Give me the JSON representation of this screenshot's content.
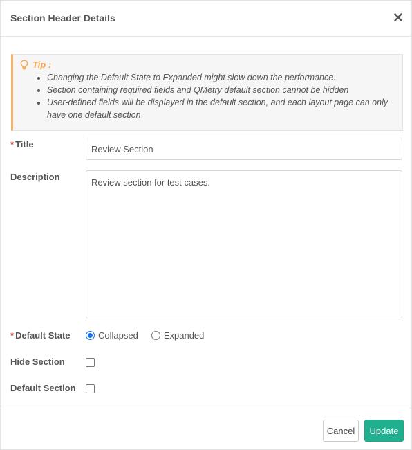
{
  "header": {
    "title": "Section Header Details",
    "close_icon": "close-icon"
  },
  "tip": {
    "label": "Tip :",
    "icon": "lightbulb-icon",
    "items": [
      "Changing the Default State to Expanded might slow down the performance.",
      "Section containing required fields and QMetry default section cannot be hidden",
      "User-defined fields will be displayed in the default section, and each layout page can only have one default section"
    ]
  },
  "form": {
    "title": {
      "required_mark": "*",
      "label": "Title",
      "value": "Review Section"
    },
    "description": {
      "label": "Description",
      "value": "Review section for test cases."
    },
    "default_state": {
      "required_mark": "*",
      "label": "Default State",
      "options": [
        "Collapsed",
        "Expanded"
      ],
      "selected": "Collapsed"
    },
    "hide_section": {
      "label": "Hide Section",
      "checked": false
    },
    "default_section": {
      "label": "Default Section",
      "checked": false
    }
  },
  "footer": {
    "cancel_label": "Cancel",
    "update_label": "Update"
  },
  "colors": {
    "accent": "#21b08f",
    "tip": "#f5a54a",
    "required": "#d9534f",
    "radio": "#1a73e8"
  }
}
